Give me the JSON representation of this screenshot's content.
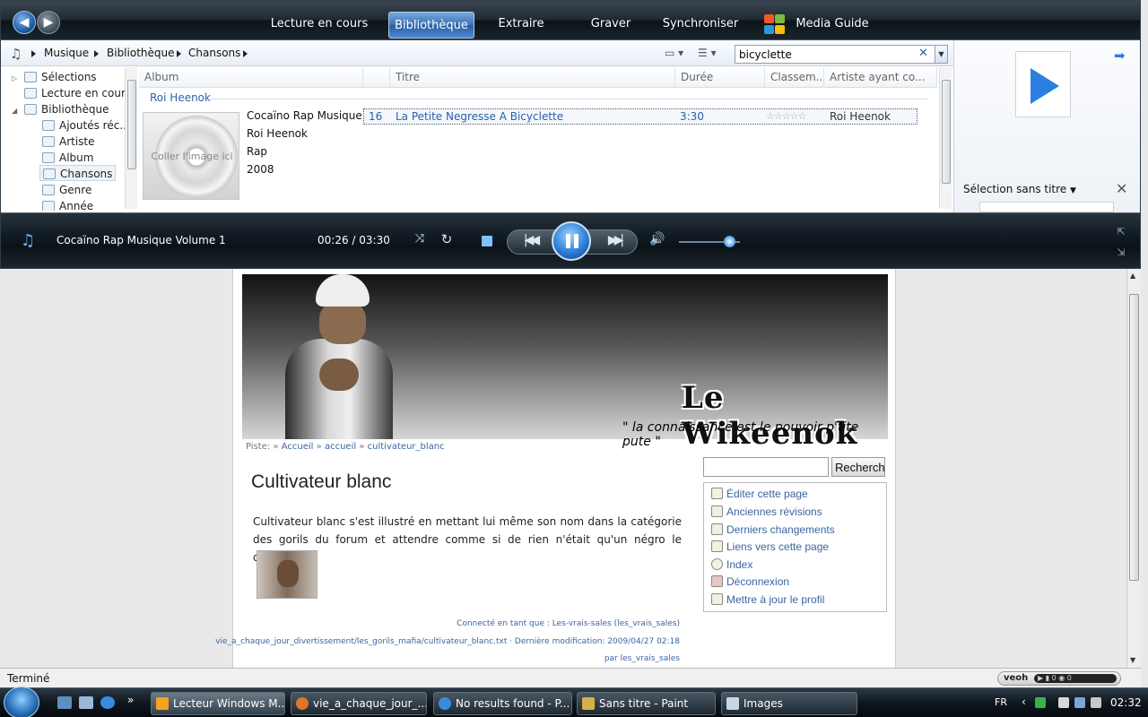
{
  "wmp": {
    "tabs": {
      "now_playing": "Lecture en cours",
      "library": "Bibliothèque",
      "rip": "Extraire",
      "burn": "Graver",
      "sync": "Synchroniser",
      "guide": "Media Guide"
    },
    "breadcrumb": [
      "Musique",
      "Bibliothèque",
      "Chansons"
    ],
    "search": {
      "value": "bicyclette",
      "clear": "✕"
    },
    "tree": {
      "playlists": "Sélections",
      "now_playing": "Lecture en cours",
      "library": "Bibliothèque",
      "recently_added": "Ajoutés réc...",
      "artist": "Artiste",
      "album": "Album",
      "songs": "Chansons",
      "genre": "Genre",
      "year": "Année"
    },
    "columns": {
      "album": "Album",
      "title": "Titre",
      "duration": "Durée",
      "rating": "Classem...",
      "contributing_artist": "Artiste ayant co..."
    },
    "group": {
      "name": "Roi Heenok",
      "art_placeholder": "Coller l'image ici",
      "album_title": "Cocaïno Rap Musique...",
      "artist": "Roi Heenok",
      "genre": "Rap",
      "year": "2008"
    },
    "track": {
      "number": "16",
      "title": "La Petite Negresse A Bicyclette",
      "duration": "3:30",
      "rating_stars": 0,
      "artist": "Roi Heenok"
    },
    "right_pane": {
      "list_title": "Sélection sans titre"
    },
    "now_playing": {
      "title": "Cocaïno Rap Musique Volume 1",
      "time": "00:26 / 03:30",
      "volume": 0.82
    }
  },
  "browser": {
    "wiki": {
      "site_title": "Le Wikeenok",
      "tagline": "\" la connaissance est le pouvoir p'tite pute \"",
      "trail_label": "Piste:",
      "trail_sep": "»",
      "trail": [
        "Accueil",
        "accueil",
        "cultivateur_blanc"
      ],
      "page_title": "Cultivateur blanc",
      "body": "Cultivateur blanc s'est illustré en mettant lui même son nom dans la catégorie des gorils du forum et attendre comme si de rien n'était qu'un négro le décrive.",
      "logged_in": "Connecté en tant que : Les-vrais-sales (les_vrais_sales)",
      "path_info": "vie_a_chaque_jour_divertissement/les_gorils_mafia/cultivateur_blanc.txt · Dernière modification: 2009/04/27 02:18",
      "by": "par les_vrais_sales",
      "search_button": "Rechercher",
      "tools": [
        "Éditer cette page",
        "Anciennes révisions",
        "Derniers changements",
        "Liens vers cette page",
        "Index",
        "Déconnexion",
        "Mettre à jour le profil"
      ]
    },
    "status": "Terminé",
    "veoh": {
      "logo": "veoh",
      "counter": "▶ ▮ 0 ◉ 0"
    }
  },
  "taskbar": {
    "tasks": [
      "Lecteur Windows M...",
      "vie_a_chaque_jour_...",
      "No results found - P...",
      "Sans titre - Paint",
      "Images"
    ],
    "lang": "FR",
    "time": "02:32"
  },
  "colors": {
    "accent_blue": "#2b5ea8",
    "link_blue": "#3c64a0",
    "wmp_dark": "#121b22",
    "taskbar_dark": "#0f171e"
  }
}
